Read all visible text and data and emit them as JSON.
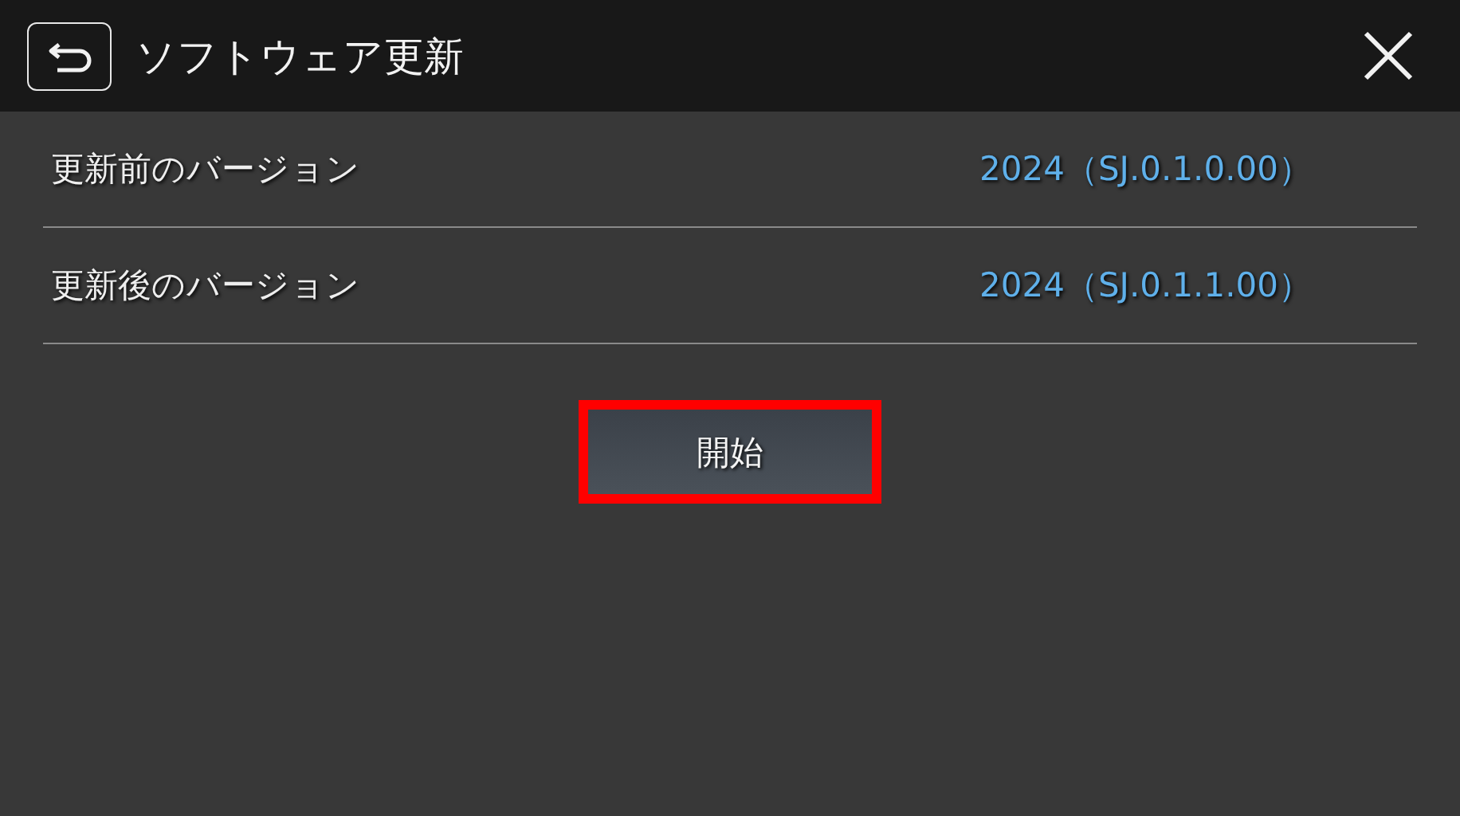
{
  "header": {
    "title": "ソフトウェア更新"
  },
  "rows": [
    {
      "label": "更新前のバージョン",
      "value": "2024（SJ.0.1.0.00）"
    },
    {
      "label": "更新後のバージョン",
      "value": "2024（SJ.0.1.1.00）"
    }
  ],
  "start_button": {
    "label": "開始",
    "highlighted": true
  }
}
